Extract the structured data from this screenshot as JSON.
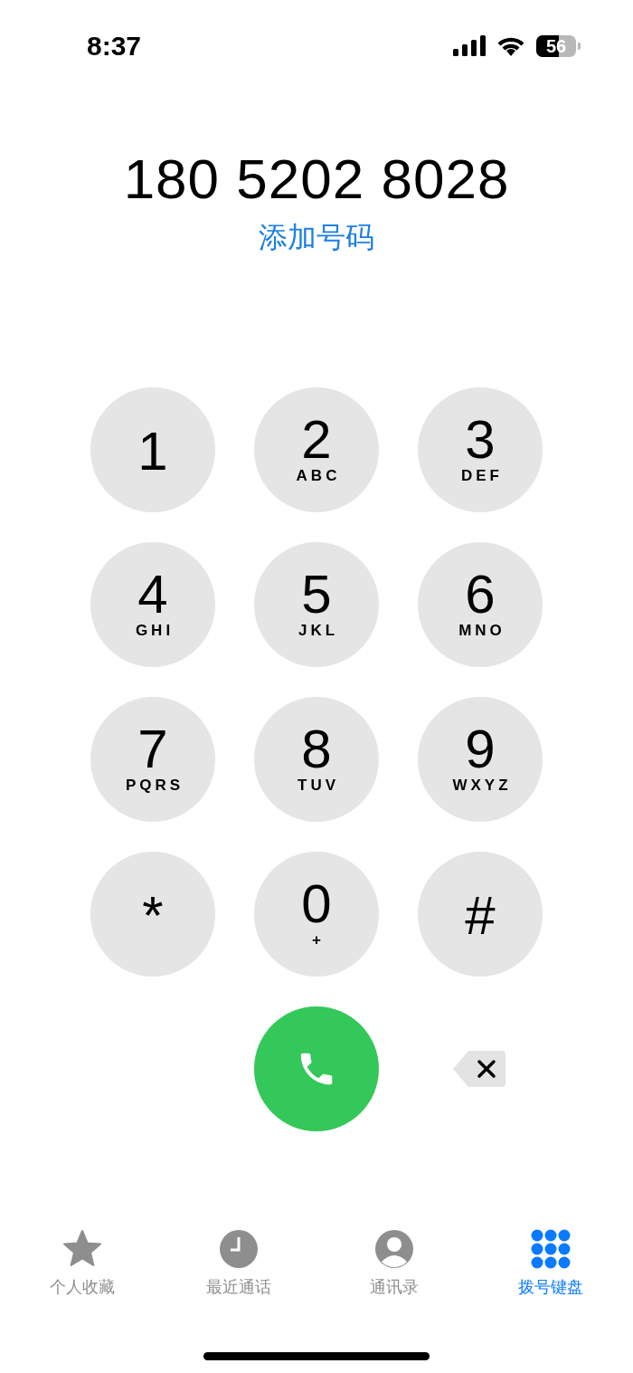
{
  "status_bar": {
    "time": "8:37",
    "battery": "56"
  },
  "dialer": {
    "number": "180 5202 8028",
    "add_number": "添加号码"
  },
  "keys": [
    {
      "digit": "1"
    },
    {
      "digit": "2",
      "letters": "ABC"
    },
    {
      "digit": "3",
      "letters": "DEF"
    },
    {
      "digit": "4",
      "letters": "GHI"
    },
    {
      "digit": "5",
      "letters": "JKL"
    },
    {
      "digit": "6",
      "letters": "MNO"
    },
    {
      "digit": "7",
      "letters": "PQRS"
    },
    {
      "digit": "8",
      "letters": "TUV"
    },
    {
      "digit": "9",
      "letters": "WXYZ"
    },
    {
      "digit": "*"
    },
    {
      "digit": "0",
      "letters": "+"
    },
    {
      "digit": "#"
    }
  ],
  "tabs": [
    {
      "kind": "star",
      "label": "个人收藏",
      "selected": false
    },
    {
      "kind": "clock",
      "label": "最近通话",
      "selected": false
    },
    {
      "kind": "person",
      "label": "通讯录",
      "selected": false
    },
    {
      "kind": "keypad",
      "label": "拨号键盘",
      "selected": true
    }
  ]
}
